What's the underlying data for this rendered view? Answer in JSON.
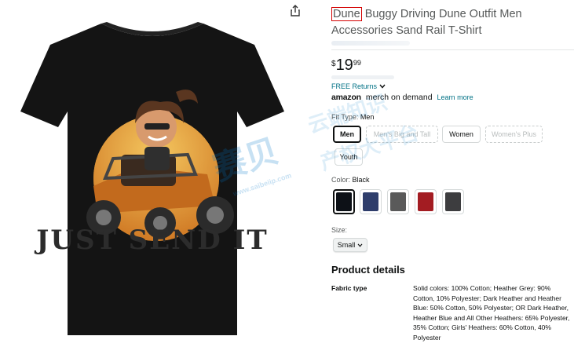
{
  "product": {
    "brand": "Dune",
    "title_rest": " Buggy Driving Dune Outfit Men Accessories Sand Rail T-Shirt",
    "shirt_print_text": "JUST SEND IT"
  },
  "price": {
    "symbol": "$",
    "whole": "19",
    "fraction": "99"
  },
  "returns": {
    "label": "FREE Returns"
  },
  "merch": {
    "amazon": "amazon",
    "demand": "merch on demand",
    "learn_more": "Learn more"
  },
  "fit_type": {
    "label": "Fit Type:",
    "selected": "Men",
    "options": [
      "Men",
      "Men's Big and Tall",
      "Women",
      "Women's Plus",
      "Youth"
    ]
  },
  "color": {
    "label": "Color:",
    "selected": "Black",
    "swatches": [
      "#0d1117",
      "#2e3d6b",
      "#5a5a5a",
      "#a31c22",
      "#3d3d3f"
    ]
  },
  "size": {
    "label": "Size:",
    "selected": "Small"
  },
  "product_details": {
    "heading": "Product details",
    "fabric_label": "Fabric type",
    "fabric_value": "Solid colors: 100% Cotton; Heather Grey: 90% Cotton, 10% Polyester; Dark Heather and Heather Blue: 50% Cotton, 50% Polyester; OR Dark Heather, Heather Blue and All Other Heathers: 65% Polyester, 35% Cotton; Girls' Heathers: 60% Cotton, 40% Polyester"
  },
  "watermark": {
    "text1": "赛贝",
    "text2": "www.saibeiip.com",
    "text3": "云端知识",
    "text4": "产权大平台"
  }
}
